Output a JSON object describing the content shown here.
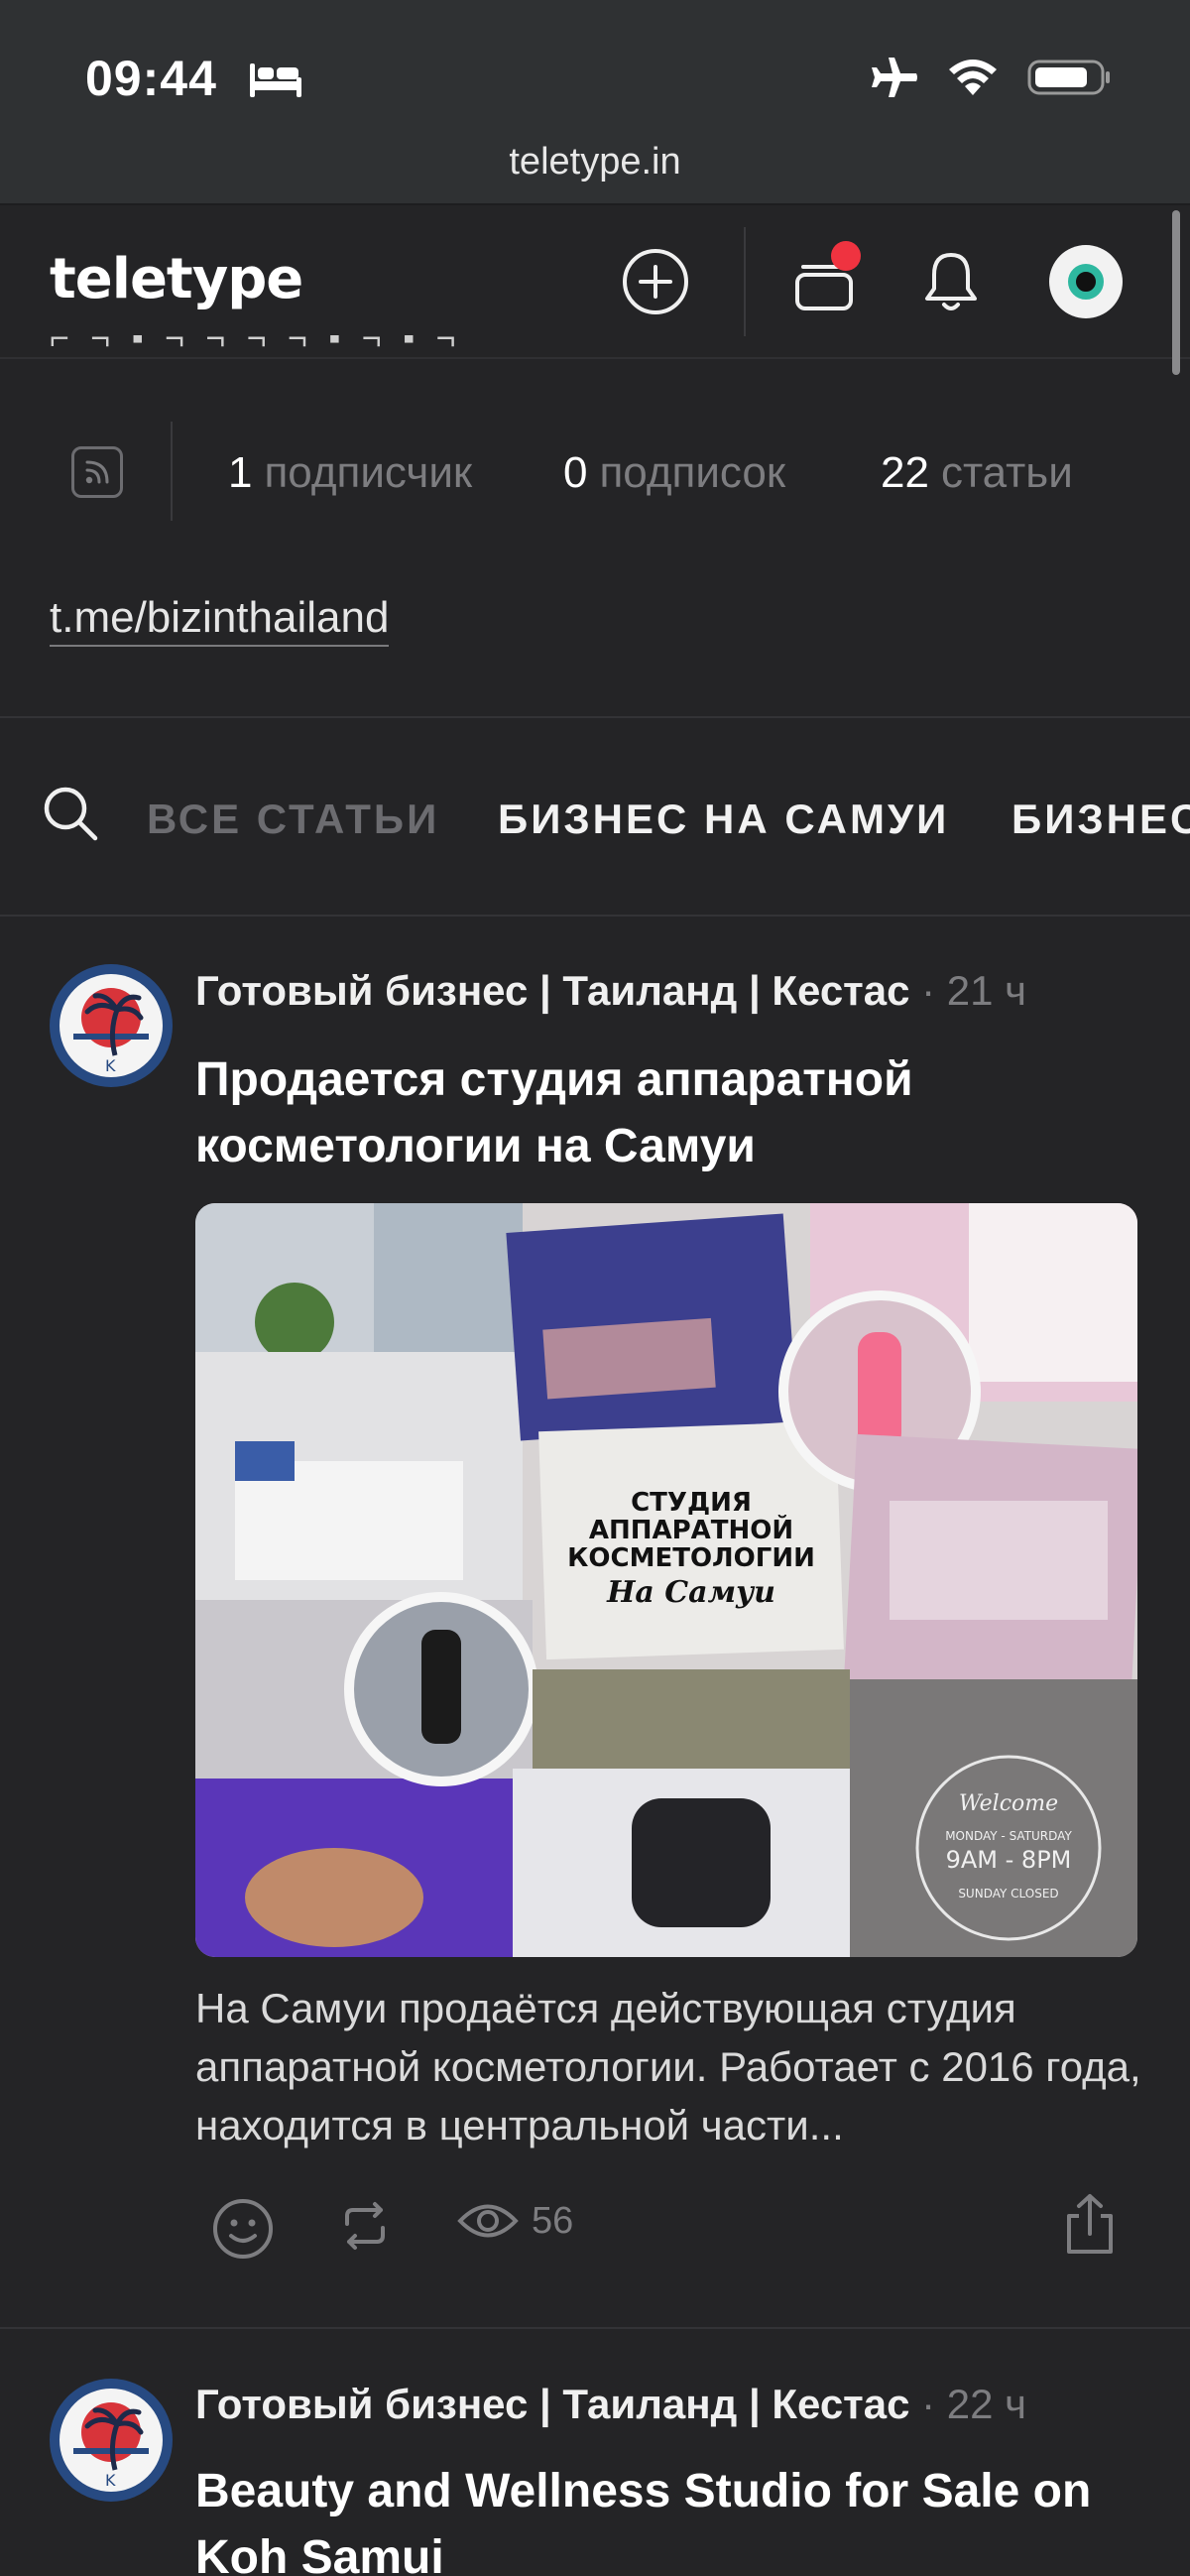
{
  "status_bar": {
    "time": "09:44"
  },
  "browser": {
    "url": "teletype.in"
  },
  "header": {
    "logo": "teletype"
  },
  "profile": {
    "stats": [
      {
        "count": "1",
        "label": "подписчик"
      },
      {
        "count": "0",
        "label": "подписок"
      },
      {
        "count": "22",
        "label": "статьи"
      }
    ],
    "link": "t.me/bizinthailand"
  },
  "tabs": [
    {
      "label": "ВСЕ СТАТЬИ",
      "active": false
    },
    {
      "label": "БИЗНЕС НА САМУИ",
      "active": true
    },
    {
      "label": "БИЗНЕС",
      "active": true
    }
  ],
  "posts": [
    {
      "author": "Готовый бизнес | Таиланд | Кестас",
      "time": "· 21 ч",
      "title": "Продается студия аппаратной косметологии на Самуи",
      "image_caption": {
        "line1": "СТУДИЯ",
        "line2": "АППАРАТНОЙ",
        "line3": "КОСМЕТОЛОГИИ",
        "line4": "На Самуи"
      },
      "image_sign": {
        "welcome": "Welcome",
        "hours": "9AM - 8PM",
        "days": "MONDAY - SATURDAY",
        "closed": "SUNDAY CLOSED"
      },
      "excerpt": "На Самуи продаётся действующая студия аппаратной косметологии. Работает с 2016 года, находится в центральной части...",
      "views": "56"
    },
    {
      "author": "Готовый бизнес | Таиланд | Кестас",
      "time": "· 22 ч",
      "title": "Beauty and Wellness Studio for Sale on Koh Samui"
    }
  ],
  "colors": {
    "background": "#242426",
    "status_bar": "#2f3133",
    "accent_red": "#ef3340",
    "muted": "#7d7d80"
  }
}
